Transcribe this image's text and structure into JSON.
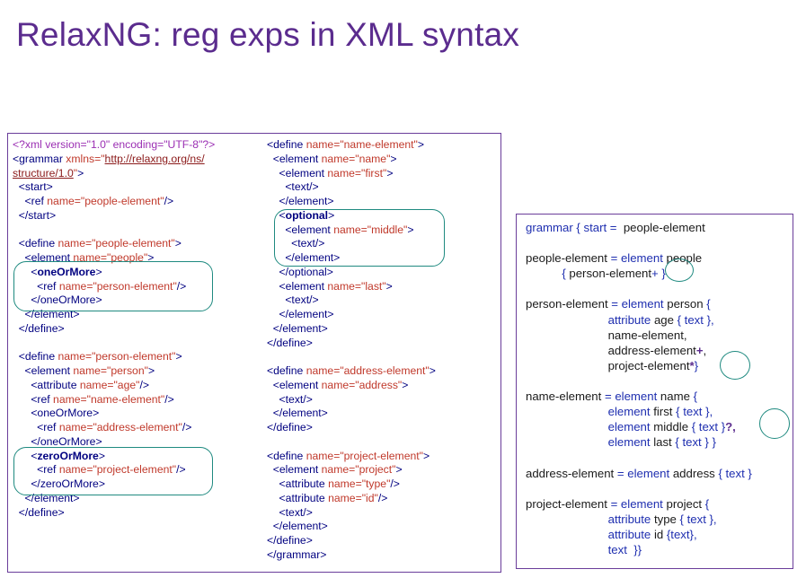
{
  "slide": {
    "title": "RelaxNG: reg exps in XML syntax"
  },
  "xml_col1": [
    [
      [
        "pi",
        "<?xml version=\"1.0\" encoding=\"UTF-8\"?>"
      ]
    ],
    [
      [
        "tag",
        "<grammar "
      ],
      [
        "an",
        "xmlns="
      ],
      [
        "av",
        "\""
      ],
      [
        "link",
        "http://relaxng.org/ns/"
      ]
    ],
    [
      [
        "link",
        "structure/1.0"
      ],
      [
        "av",
        "\""
      ],
      [
        "tag",
        ">"
      ]
    ],
    [
      [
        "tag",
        "  <start>"
      ]
    ],
    [
      [
        "tag",
        "    <ref "
      ],
      [
        "an",
        "name="
      ],
      [
        "av",
        "\"people-element\""
      ],
      [
        "tag",
        "/>"
      ]
    ],
    [
      [
        "tag",
        "  </start>"
      ]
    ],
    [
      [
        "tag",
        ""
      ]
    ],
    [
      [
        "tag",
        "  <define "
      ],
      [
        "an",
        "name="
      ],
      [
        "av",
        "\"people-element\""
      ],
      [
        "tag",
        ">"
      ]
    ],
    [
      [
        "tag",
        "    <element "
      ],
      [
        "an",
        "name="
      ],
      [
        "av",
        "\"people\""
      ],
      [
        "tag",
        ">"
      ]
    ],
    [
      [
        "tag",
        "      <"
      ],
      [
        "tagb",
        "oneOrMore"
      ],
      [
        "tag",
        ">"
      ]
    ],
    [
      [
        "tag",
        "        <ref "
      ],
      [
        "an",
        "name="
      ],
      [
        "av",
        "\"person-element\""
      ],
      [
        "tag",
        "/>"
      ]
    ],
    [
      [
        "tag",
        "      </oneOrMore>"
      ]
    ],
    [
      [
        "tag",
        "    </element>"
      ]
    ],
    [
      [
        "tag",
        "  </define>"
      ]
    ],
    [
      [
        "tag",
        ""
      ]
    ],
    [
      [
        "tag",
        "  <define "
      ],
      [
        "an",
        "name="
      ],
      [
        "av",
        "\"person-element\""
      ],
      [
        "tag",
        ">"
      ]
    ],
    [
      [
        "tag",
        "    <element "
      ],
      [
        "an",
        "name="
      ],
      [
        "av",
        "\"person\""
      ],
      [
        "tag",
        ">"
      ]
    ],
    [
      [
        "tag",
        "      <attribute "
      ],
      [
        "an",
        "name="
      ],
      [
        "av",
        "\"age\""
      ],
      [
        "tag",
        "/>"
      ]
    ],
    [
      [
        "tag",
        "      <ref "
      ],
      [
        "an",
        "name="
      ],
      [
        "av",
        "\"name-element\""
      ],
      [
        "tag",
        "/>"
      ]
    ],
    [
      [
        "tag",
        "      <oneOrMore>"
      ]
    ],
    [
      [
        "tag",
        "        <ref "
      ],
      [
        "an",
        "name="
      ],
      [
        "av",
        "\"address-element\""
      ],
      [
        "tag",
        "/>"
      ]
    ],
    [
      [
        "tag",
        "      </oneOrMore>"
      ]
    ],
    [
      [
        "tag",
        "      <"
      ],
      [
        "tagb",
        "zeroOrMore"
      ],
      [
        "tag",
        ">"
      ]
    ],
    [
      [
        "tag",
        "        <ref "
      ],
      [
        "an",
        "name="
      ],
      [
        "av",
        "\"project-element\""
      ],
      [
        "tag",
        "/>"
      ]
    ],
    [
      [
        "tag",
        "      </zeroOrMore>"
      ]
    ],
    [
      [
        "tag",
        "    </element>"
      ]
    ],
    [
      [
        "tag",
        "  </define>"
      ]
    ]
  ],
  "xml_col2": [
    [
      [
        "tag",
        "<define "
      ],
      [
        "an",
        "name="
      ],
      [
        "av",
        "\"name-element\""
      ],
      [
        "tag",
        ">"
      ]
    ],
    [
      [
        "tag",
        "  <element "
      ],
      [
        "an",
        "name="
      ],
      [
        "av",
        "\"name\""
      ],
      [
        "tag",
        ">"
      ]
    ],
    [
      [
        "tag",
        "    <element "
      ],
      [
        "an",
        "name="
      ],
      [
        "av",
        "\"first\""
      ],
      [
        "tag",
        ">"
      ]
    ],
    [
      [
        "tag",
        "      <text/>"
      ]
    ],
    [
      [
        "tag",
        "    </element>"
      ]
    ],
    [
      [
        "tag",
        "    <"
      ],
      [
        "tagb",
        "optional"
      ],
      [
        "tag",
        ">"
      ]
    ],
    [
      [
        "tag",
        "      <element "
      ],
      [
        "an",
        "name="
      ],
      [
        "av",
        "\"middle\""
      ],
      [
        "tag",
        ">"
      ]
    ],
    [
      [
        "tag",
        "        <text/>"
      ]
    ],
    [
      [
        "tag",
        "      </element>"
      ]
    ],
    [
      [
        "tag",
        "    </optional>"
      ]
    ],
    [
      [
        "tag",
        "    <element "
      ],
      [
        "an",
        "name="
      ],
      [
        "av",
        "\"last\""
      ],
      [
        "tag",
        ">"
      ]
    ],
    [
      [
        "tag",
        "      <text/>"
      ]
    ],
    [
      [
        "tag",
        "    </element>"
      ]
    ],
    [
      [
        "tag",
        "  </element>"
      ]
    ],
    [
      [
        "tag",
        "</define>"
      ]
    ],
    [
      [
        "tag",
        ""
      ]
    ],
    [
      [
        "tag",
        "<define "
      ],
      [
        "an",
        "name="
      ],
      [
        "av",
        "\"address-element\""
      ],
      [
        "tag",
        ">"
      ]
    ],
    [
      [
        "tag",
        "  <element "
      ],
      [
        "an",
        "name="
      ],
      [
        "av",
        "\"address\""
      ],
      [
        "tag",
        ">"
      ]
    ],
    [
      [
        "tag",
        "    <text/>"
      ]
    ],
    [
      [
        "tag",
        "  </element>"
      ]
    ],
    [
      [
        "tag",
        "</define>"
      ]
    ],
    [
      [
        "tag",
        ""
      ]
    ],
    [
      [
        "tag",
        "<define "
      ],
      [
        "an",
        "name="
      ],
      [
        "av",
        "\"project-element\""
      ],
      [
        "tag",
        ">"
      ]
    ],
    [
      [
        "tag",
        "  <element "
      ],
      [
        "an",
        "name="
      ],
      [
        "av",
        "\"project\""
      ],
      [
        "tag",
        ">"
      ]
    ],
    [
      [
        "tag",
        "    <attribute "
      ],
      [
        "an",
        "name="
      ],
      [
        "av",
        "\"type\""
      ],
      [
        "tag",
        "/>"
      ]
    ],
    [
      [
        "tag",
        "    <attribute "
      ],
      [
        "an",
        "name="
      ],
      [
        "av",
        "\"id\""
      ],
      [
        "tag",
        "/>"
      ]
    ],
    [
      [
        "tag",
        "    <text/>"
      ]
    ],
    [
      [
        "tag",
        "  </element>"
      ]
    ],
    [
      [
        "tag",
        "</define>"
      ]
    ],
    [
      [
        "tag",
        "</grammar>"
      ]
    ]
  ],
  "rnc_lines": [
    [
      [
        "kw",
        "grammar { start = "
      ],
      [
        "tx",
        " people-element"
      ]
    ],
    [
      [
        "tx",
        ""
      ]
    ],
    [
      [
        "tx",
        "people-element "
      ],
      [
        "kw",
        "= element "
      ],
      [
        "tx",
        "people"
      ]
    ],
    [
      [
        "tx",
        "           "
      ],
      [
        "kw",
        "{ "
      ],
      [
        "tx",
        "person-element"
      ],
      [
        "kw",
        "+ }"
      ]
    ],
    [
      [
        "tx",
        ""
      ]
    ],
    [
      [
        "tx",
        "person-element "
      ],
      [
        "kw",
        "= element "
      ],
      [
        "tx",
        "person "
      ],
      [
        "kw",
        "{"
      ]
    ],
    [
      [
        "tx",
        "                         "
      ],
      [
        "kw",
        "attribute "
      ],
      [
        "tx",
        "age "
      ],
      [
        "kw",
        "{ text },"
      ]
    ],
    [
      [
        "tx",
        "                         name-element,"
      ]
    ],
    [
      [
        "tx",
        "                         address-element"
      ],
      [
        "bp",
        "+"
      ],
      [
        "tx",
        ","
      ]
    ],
    [
      [
        "tx",
        "                         project-element"
      ],
      [
        "bp",
        "*"
      ],
      [
        "kw",
        "}"
      ]
    ],
    [
      [
        "tx",
        ""
      ]
    ],
    [
      [
        "tx",
        "name-element "
      ],
      [
        "kw",
        "= element "
      ],
      [
        "tx",
        "name "
      ],
      [
        "kw",
        "{"
      ]
    ],
    [
      [
        "tx",
        "                         "
      ],
      [
        "kw",
        "element "
      ],
      [
        "tx",
        "first "
      ],
      [
        "kw",
        "{ text },"
      ]
    ],
    [
      [
        "tx",
        "                         "
      ],
      [
        "kw",
        "element "
      ],
      [
        "tx",
        "middle "
      ],
      [
        "kw",
        "{ text }"
      ],
      [
        "bp",
        "?,"
      ]
    ],
    [
      [
        "tx",
        "                         "
      ],
      [
        "kw",
        "element "
      ],
      [
        "tx",
        "last "
      ],
      [
        "kw",
        "{ text } }"
      ]
    ],
    [
      [
        "tx",
        ""
      ]
    ],
    [
      [
        "tx",
        "address-element "
      ],
      [
        "kw",
        "= element "
      ],
      [
        "tx",
        "address "
      ],
      [
        "kw",
        "{ text }"
      ]
    ],
    [
      [
        "tx",
        ""
      ]
    ],
    [
      [
        "tx",
        "project-element "
      ],
      [
        "kw",
        "= element "
      ],
      [
        "tx",
        "project "
      ],
      [
        "kw",
        "{"
      ]
    ],
    [
      [
        "tx",
        "                         "
      ],
      [
        "kw",
        "attribute "
      ],
      [
        "tx",
        "type "
      ],
      [
        "kw",
        "{ text },"
      ]
    ],
    [
      [
        "tx",
        "                         "
      ],
      [
        "kw",
        "attribute "
      ],
      [
        "tx",
        "id "
      ],
      [
        "kw",
        "{text},"
      ]
    ],
    [
      [
        "tx",
        "                         "
      ],
      [
        "kw",
        "text  }}"
      ]
    ]
  ]
}
